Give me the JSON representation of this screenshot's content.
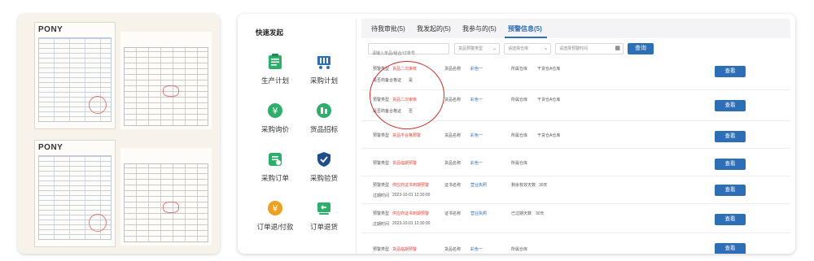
{
  "documents": {
    "brand": "PONY",
    "colors": {
      "panel_bg": "#f7f3ea",
      "stamp": "#d9534f"
    }
  },
  "quick_launch": {
    "title": "快速发起",
    "items": [
      {
        "label": "生产计划",
        "icon": "production-plan-icon",
        "color": "#2eae6b"
      },
      {
        "label": "采购计划",
        "icon": "purchase-cart-icon",
        "color": "#2d6fb6"
      },
      {
        "label": "采购询价",
        "icon": "inquiry-yen-icon",
        "color": "#2eae6b"
      },
      {
        "label": "货品招标",
        "icon": "bid-tag-icon",
        "color": "#2eae6b"
      },
      {
        "label": "采购订单",
        "icon": "order-doc-icon",
        "color": "#2eae6b"
      },
      {
        "label": "采购验货",
        "icon": "inspection-shield-icon",
        "color": "#1f4f8a"
      },
      {
        "label": "订单退/付款",
        "icon": "refund-yen-icon",
        "color": "#f0a020"
      },
      {
        "label": "订单退货",
        "icon": "return-truck-icon",
        "color": "#2eae6b"
      }
    ]
  },
  "tabs": [
    {
      "label": "待我审批(5)"
    },
    {
      "label": "我发起的(5)"
    },
    {
      "label": "我参与的(5)"
    },
    {
      "label": "预警信息(5)",
      "active": true
    }
  ],
  "filters": {
    "keyword_placeholder": "请输入单品/组合/订单号",
    "status_placeholder": "货品预警类型",
    "warehouse_placeholder": "请选择仓库",
    "time_placeholder": "请选择预警时间",
    "search_label": "查询"
  },
  "rows": [
    {
      "type_label": "预警类型",
      "type_value": "货品二次审核",
      "extra_label": "是否商备合格证",
      "extra_value": "是",
      "name_label": "货品名称",
      "name_value": "彩色一",
      "wh_label": "所属仓库",
      "wh_value": "干货仓A仓库",
      "btn": "查看"
    },
    {
      "type_label": "预警类型",
      "type_value": "货品二次审核",
      "extra_label": "是否商备合格证",
      "extra_value": "否",
      "name_label": "货品名称",
      "name_value": "彩色一",
      "wh_label": "所属仓库",
      "wh_value": "干货仓A仓库",
      "btn": "查看"
    },
    {
      "type_label": "预警类型",
      "type_value": "货品不合格预警",
      "name_label": "货品名称",
      "name_value": "彩色一",
      "wh_label": "所属仓库",
      "wh_value": "干货仓A仓库",
      "btn": "查看"
    },
    {
      "type_label": "预警类型",
      "type_value": "货品临期预警",
      "name_label": "货品名称",
      "name_value": "彩色一",
      "wh_label": "所属仓库",
      "wh_value": "",
      "btn": "查看"
    },
    {
      "type_label": "预警类型",
      "type_value": "供应商证书到期预警",
      "extra_label": "过期时间",
      "extra_value": "2023-10-01 12:30:00",
      "name_label": "证书名称",
      "name_value": "营业执照",
      "wh_label": "剩余有效天数",
      "wh_value": "30天",
      "btn": "查看"
    },
    {
      "type_label": "预警类型",
      "type_value": "供应商证书到期预警",
      "extra_label": "过期时间",
      "extra_value": "2023-10-01 12:30:00",
      "name_label": "证书名称",
      "name_value": "营业执照",
      "wh_label": "已过期天数",
      "wh_value": "30天",
      "btn": "查看"
    },
    {
      "type_label": "预警类型",
      "type_value": "货品临期预警",
      "name_label": "货品名称",
      "name_value": "彩色一",
      "wh_label": "所属仓库",
      "wh_value": "",
      "btn": "查看"
    }
  ]
}
